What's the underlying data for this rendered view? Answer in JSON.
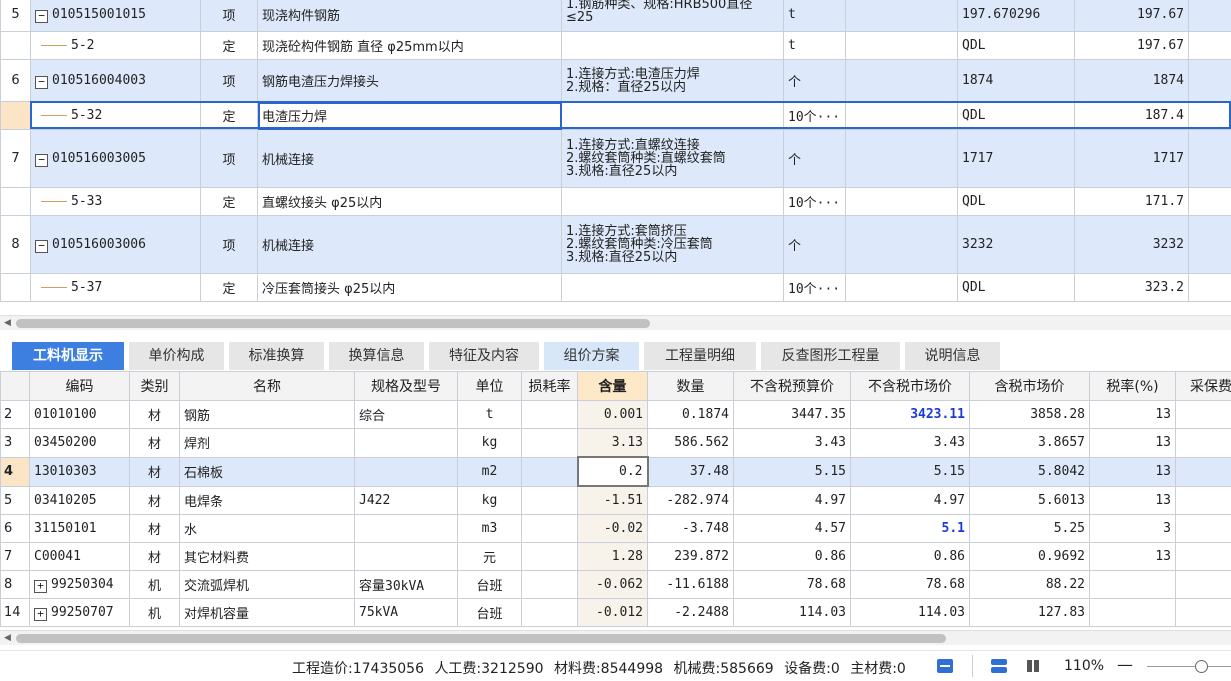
{
  "top_rows": [
    {
      "kind": "item",
      "index": "5",
      "code": "010515001015",
      "type": "项",
      "name": "现浇构件钢筋",
      "features": "1.钢筋种类、规格:HRB500直径≤25",
      "unit": "t",
      "qty_expr": "197.670296",
      "qty": "197.67"
    },
    {
      "kind": "sub",
      "index": "",
      "code": "5-2",
      "type": "定",
      "name": "现浇砼构件钢筋 直径 φ25mm以内",
      "features": "",
      "unit": "t",
      "qty_expr": "QDL",
      "qty": "197.67"
    },
    {
      "kind": "item",
      "index": "6",
      "code": "010516004003",
      "type": "项",
      "name": "钢筋电渣压力焊接头",
      "features": "1.连接方式:电渣压力焊\n2.规格：直径25以内",
      "unit": "个",
      "qty_expr": "1874",
      "qty": "1874"
    },
    {
      "kind": "sel",
      "index": "",
      "code": "5-32",
      "type": "定",
      "name": "电渣压力焊",
      "features": "",
      "unit": "10个···",
      "qty_expr": "QDL",
      "qty": "187.4"
    },
    {
      "kind": "item",
      "index": "7",
      "code": "010516003005",
      "type": "项",
      "name": "机械连接",
      "features": "1.连接方式:直螺纹连接\n2.螺纹套筒种类:直螺纹套筒\n3.规格:直径25以内",
      "unit": "个",
      "qty_expr": "1717",
      "qty": "1717"
    },
    {
      "kind": "sub",
      "index": "",
      "code": "5-33",
      "type": "定",
      "name": "直螺纹接头 φ25以内",
      "features": "",
      "unit": "10个···",
      "qty_expr": "QDL",
      "qty": "171.7"
    },
    {
      "kind": "item",
      "index": "8",
      "code": "010516003006",
      "type": "项",
      "name": "机械连接",
      "features": "1.连接方式:套筒挤压\n2.螺纹套筒种类:冷压套筒\n3.规格:直径25以内",
      "unit": "个",
      "qty_expr": "3232",
      "qty": "3232"
    },
    {
      "kind": "sub",
      "index": "",
      "code": "5-37",
      "type": "定",
      "name": "冷压套筒接头 φ25以内",
      "features": "",
      "unit": "10个···",
      "qty_expr": "QDL",
      "qty": "323.2"
    }
  ],
  "tabs": [
    "工料机显示",
    "单价构成",
    "标准换算",
    "换算信息",
    "特征及内容",
    "组价方案",
    "工程量明细",
    "反查图形工程量",
    "说明信息"
  ],
  "bottom_headers": [
    "编码",
    "类别",
    "名称",
    "规格及型号",
    "单位",
    "损耗率",
    "含量",
    "数量",
    "不含税预算价",
    "不含税市场价",
    "含税市场价",
    "税率(%)",
    "采保费率"
  ],
  "bottom_rows": [
    {
      "rn": "2",
      "code": "01010100",
      "cat": "材",
      "name": "钢筋",
      "spec": "综合",
      "unit": "t",
      "loss": "",
      "amount": "0.001",
      "qty": "0.1874",
      "budget": "3447.35",
      "market": "3423.11",
      "market_tax": "3858.28",
      "rate": "13",
      "fee": ""
    },
    {
      "rn": "3",
      "code": "03450200",
      "cat": "材",
      "name": "焊剂",
      "spec": "",
      "unit": "kg",
      "loss": "",
      "amount": "3.13",
      "qty": "586.562",
      "budget": "3.43",
      "market": "3.43",
      "market_tax": "3.8657",
      "rate": "13",
      "fee": ""
    },
    {
      "rn": "4",
      "code": "13010303",
      "cat": "材",
      "name": "石棉板",
      "spec": "",
      "unit": "m2",
      "loss": "",
      "amount": "0.2",
      "qty": "37.48",
      "budget": "5.15",
      "market": "5.15",
      "market_tax": "5.8042",
      "rate": "13",
      "fee": ""
    },
    {
      "rn": "5",
      "code": "03410205",
      "cat": "材",
      "name": "电焊条",
      "spec": "J422",
      "unit": "kg",
      "loss": "",
      "amount": "-1.51",
      "qty": "-282.974",
      "budget": "4.97",
      "market": "4.97",
      "market_tax": "5.6013",
      "rate": "13",
      "fee": ""
    },
    {
      "rn": "6",
      "code": "31150101",
      "cat": "材",
      "name": "水",
      "spec": "",
      "unit": "m3",
      "loss": "",
      "amount": "-0.02",
      "qty": "-3.748",
      "budget": "4.57",
      "market": "5.1",
      "market_tax": "5.25",
      "rate": "3",
      "fee": ""
    },
    {
      "rn": "7",
      "code": "C00041",
      "cat": "材",
      "name": "其它材料费",
      "spec": "",
      "unit": "元",
      "loss": "",
      "amount": "1.28",
      "qty": "239.872",
      "budget": "0.86",
      "market": "0.86",
      "market_tax": "0.9692",
      "rate": "13",
      "fee": ""
    },
    {
      "rn": "8",
      "code": "99250304",
      "cat": "机",
      "name": "交流弧焊机",
      "spec": "容量30kVA",
      "unit": "台班",
      "loss": "",
      "amount": "-0.062",
      "qty": "-11.6188",
      "budget": "78.68",
      "market": "78.68",
      "market_tax": "88.22",
      "rate": "",
      "fee": ""
    },
    {
      "rn": "14",
      "code": "99250707",
      "cat": "机",
      "name": "对焊机容量",
      "spec": "75kVA",
      "unit": "台班",
      "loss": "",
      "amount": "-0.012",
      "qty": "-2.2488",
      "budget": "114.03",
      "market": "114.03",
      "market_tax": "127.83",
      "rate": "",
      "fee": ""
    }
  ],
  "status": {
    "total": "工程造价:17435056",
    "labor": "人工费:3212590",
    "material": "材料费:8544998",
    "machine": "机械费:585669",
    "equipment": "设备费:0",
    "main_material": "主材费:0",
    "zoom": "110%"
  },
  "colors": {
    "accent": "#3d7fe0",
    "selected_row": "#dde9fb",
    "edit_outline": "#2a66c9",
    "highlight_value": "#1a3ad6"
  }
}
